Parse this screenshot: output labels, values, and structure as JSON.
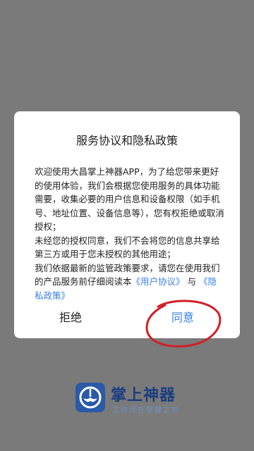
{
  "dialog": {
    "title": "服务协议和隐私政策",
    "intro": "欢迎使用大昌掌上神器APP，为了给您带来更好的使用体验，我们会根据您使用服务的具体功能需要，收集必要的用户信息和设备权限（如手机号、地址位置、设备信息等），您有权拒绝或取消授权；",
    "consent": "未经您的授权同意，我们不会将您的信息共享给第三方或用于您未授权的其他用途；",
    "regulation_prefix": "我们依据最新的监管政策要求，请您在使用我们的产品服务前仔细阅读本",
    "user_agreement_link": "《用户协议》",
    "and_text": " 与 ",
    "privacy_policy_link": "《隐私政策》",
    "refuse_label": "拒绝",
    "agree_label": "同意"
  },
  "brand": {
    "name": "掌上神器",
    "slogan": "工作尽在掌握之中"
  },
  "colors": {
    "accent": "#3a80e6",
    "annotation": "#d0202a",
    "brand": "#1b3e80"
  }
}
